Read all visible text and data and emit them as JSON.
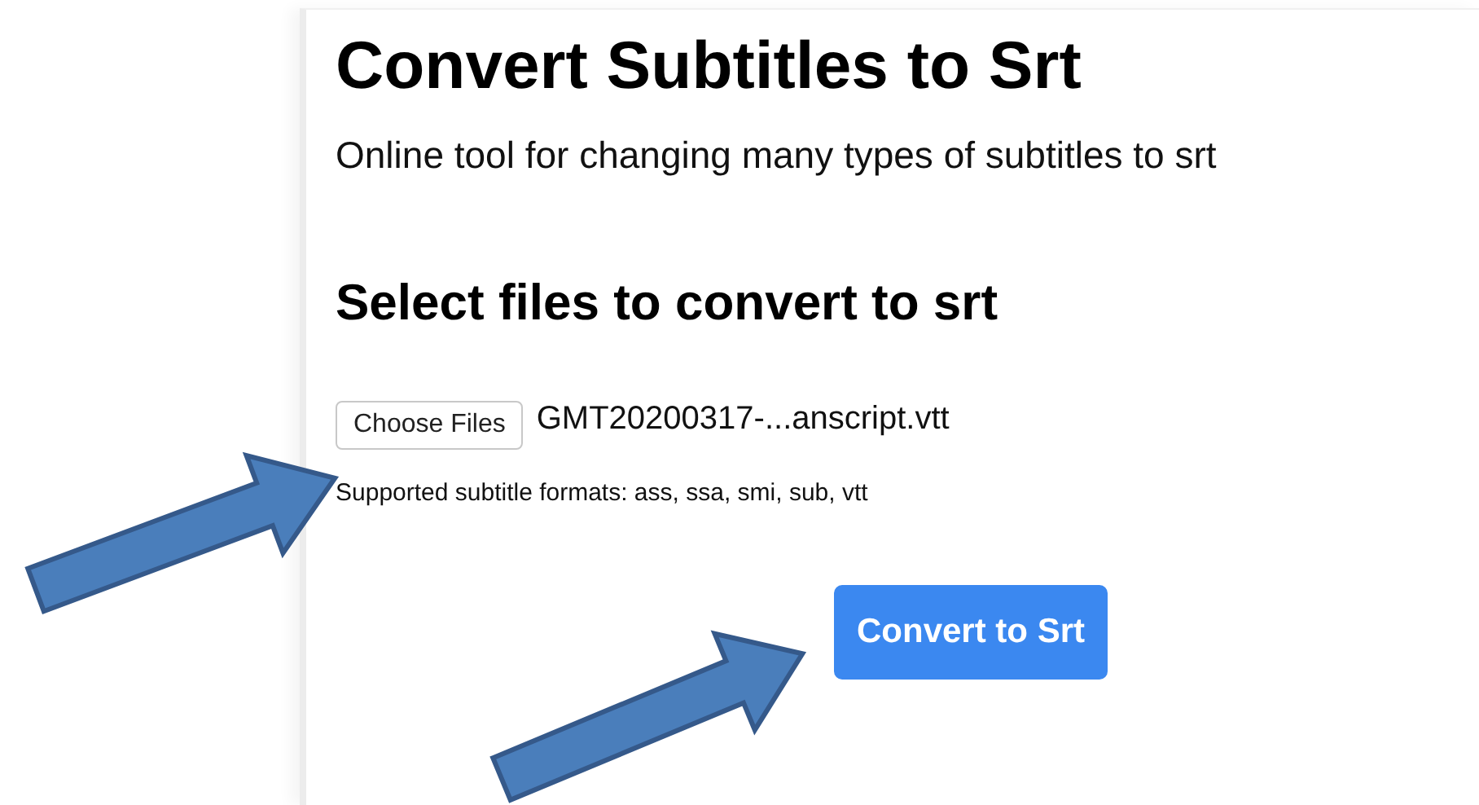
{
  "page": {
    "title": "Convert Subtitles to Srt",
    "subtitle": "Online tool for changing many types of subtitles to srt",
    "section_heading": "Select files to convert to srt",
    "file_input": {
      "button_label": "Choose Files",
      "file_name": "GMT20200317-...anscript.vtt"
    },
    "supported_formats": "Supported subtitle formats: ass, ssa, smi, sub, vtt",
    "convert_button": "Convert to Srt"
  }
}
